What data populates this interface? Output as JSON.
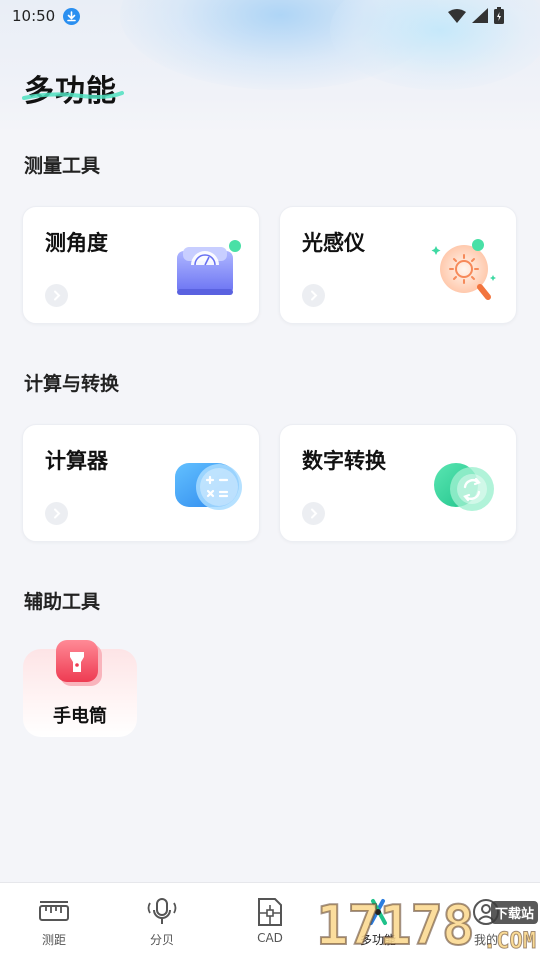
{
  "status_bar": {
    "time": "10:50"
  },
  "page": {
    "title": "多功能"
  },
  "sections": {
    "measure": {
      "title": "测量工具",
      "cards": [
        {
          "label": "测角度",
          "icon": "protractor-icon"
        },
        {
          "label": "光感仪",
          "icon": "light-sensor-icon"
        }
      ]
    },
    "calc": {
      "title": "计算与转换",
      "cards": [
        {
          "label": "计算器",
          "icon": "calculator-icon"
        },
        {
          "label": "数字转换",
          "icon": "number-convert-icon"
        }
      ]
    },
    "aux": {
      "title": "辅助工具",
      "cards": [
        {
          "label": "手电筒",
          "icon": "flashlight-icon"
        }
      ]
    }
  },
  "tabbar": {
    "active": "多功能",
    "items": [
      {
        "label": "测距",
        "icon": "ruler-icon"
      },
      {
        "label": "分贝",
        "icon": "microphone-icon"
      },
      {
        "label": "CAD",
        "icon": "cad-icon"
      },
      {
        "label": "多功能",
        "icon": "tools-icon"
      },
      {
        "label": "我的",
        "icon": "profile-icon"
      }
    ]
  },
  "watermark": {
    "digits": "17178",
    "badge": "下载站",
    "suffix": ".COM"
  },
  "colors": {
    "background": "#f4f5f9",
    "accent_green": "#3ed9a3",
    "calculator_blue": "#3aa0f0",
    "light_sensor_orange": "#f68a5a",
    "flashlight_red": "#f04a5c"
  }
}
